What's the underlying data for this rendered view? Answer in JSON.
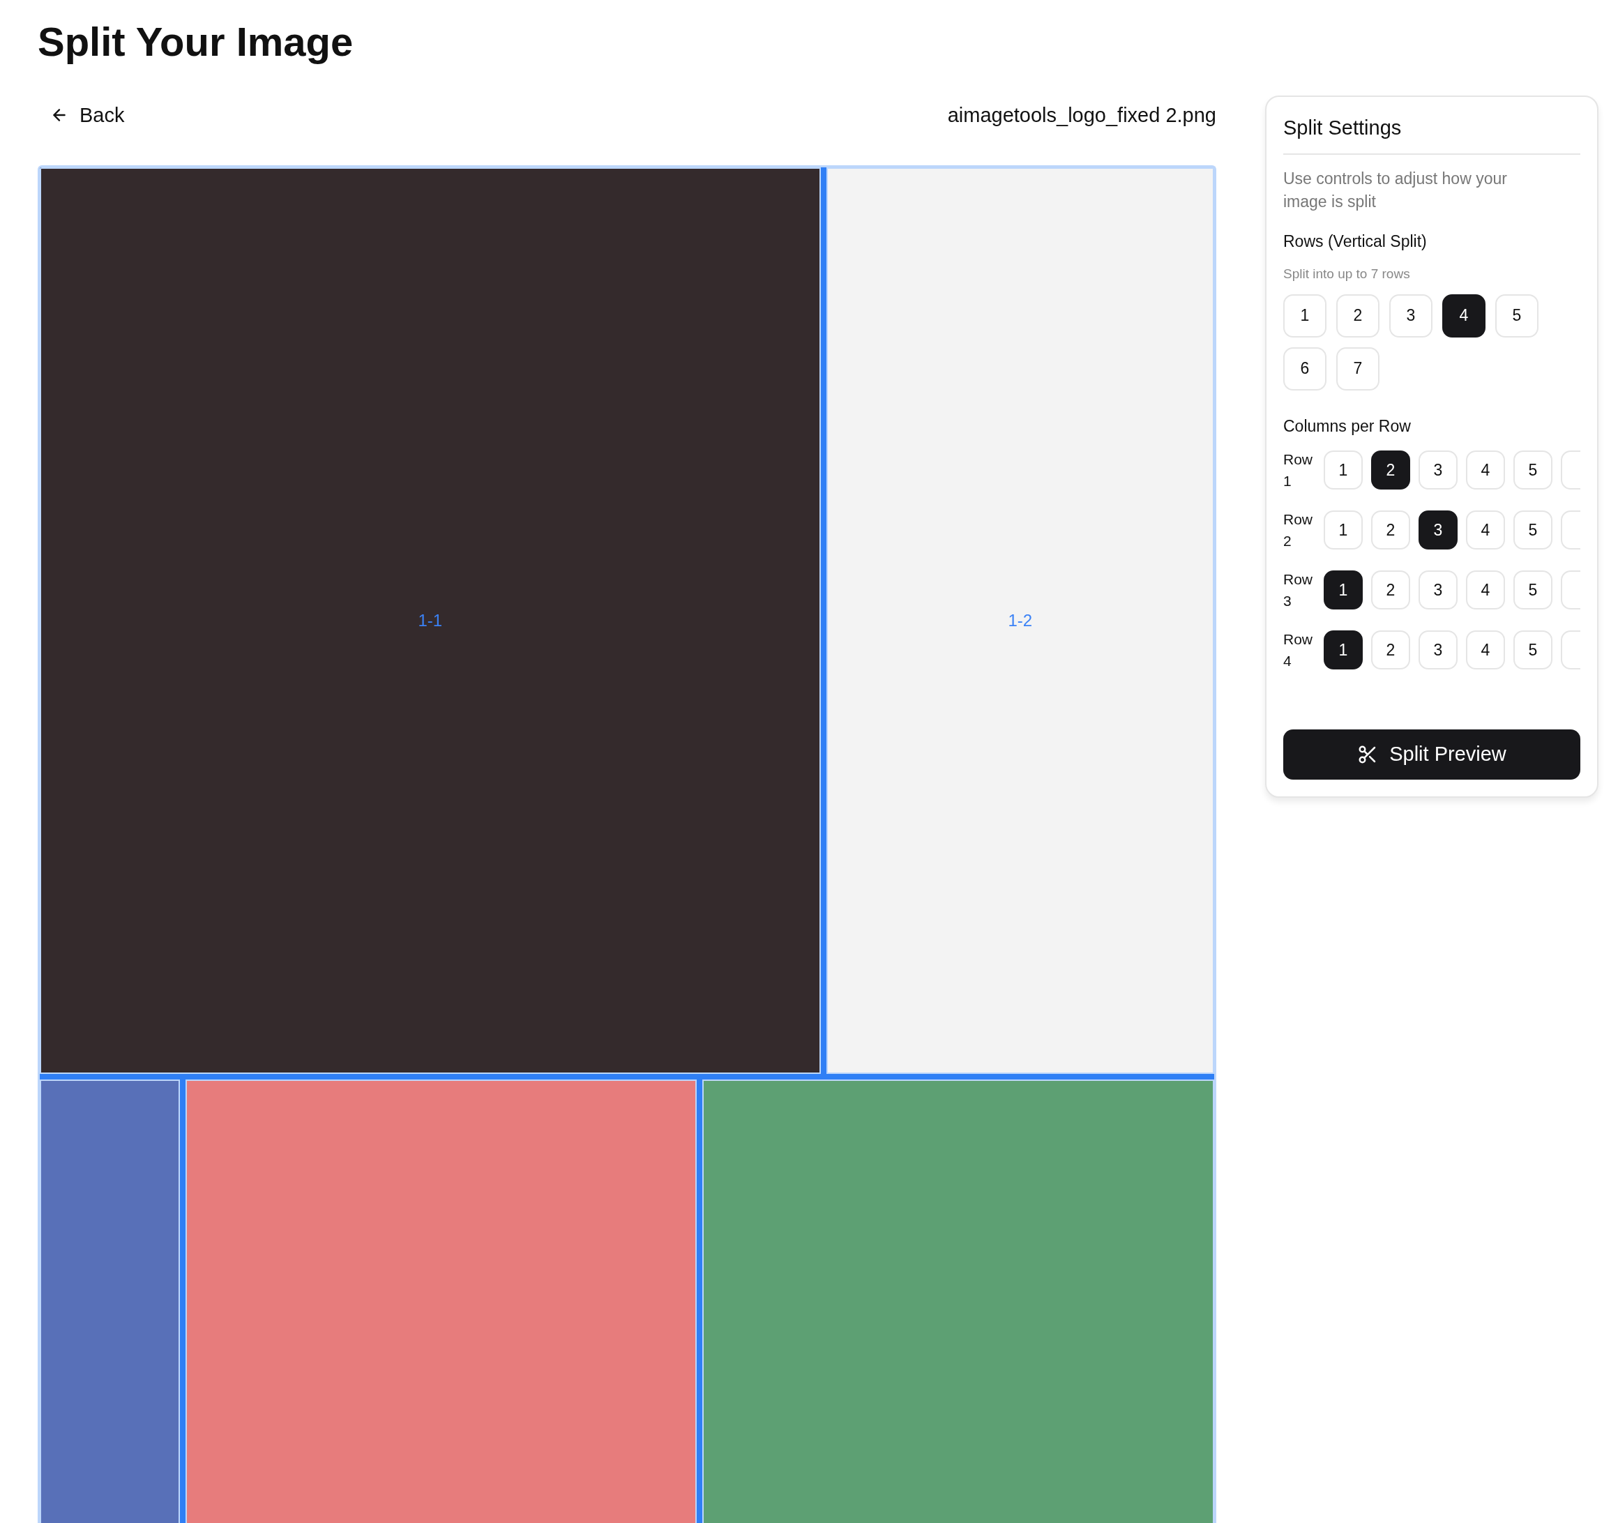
{
  "page_title": "Split Your Image",
  "back_link": "Back",
  "file_name": "aimagetools_logo_fixed 2.png",
  "preview": {
    "rows": [
      {
        "cells": [
          {
            "label": "1-1",
            "color": "#342a2c"
          },
          {
            "label": "1-2",
            "color": "#f3f3f3"
          }
        ]
      },
      {
        "cells": [
          {
            "color": "#5870b8"
          },
          {
            "color": "#e77c7c"
          },
          {
            "color": "#5da073"
          }
        ]
      }
    ]
  },
  "settings": {
    "title": "Split Settings",
    "description": "Use controls to adjust how your image is split",
    "rows_heading": "Rows (Vertical Split)",
    "rows_hint": "Split into up to 7 rows",
    "row_options": [
      {
        "label": "1",
        "selected": false
      },
      {
        "label": "2",
        "selected": false
      },
      {
        "label": "3",
        "selected": false
      },
      {
        "label": "4",
        "selected": true
      },
      {
        "label": "5",
        "selected": false
      },
      {
        "label": "6",
        "selected": false
      },
      {
        "label": "7",
        "selected": false
      }
    ],
    "columns_heading": "Columns per Row",
    "column_rows": [
      {
        "label": "Row 1",
        "options": [
          {
            "label": "1",
            "selected": false
          },
          {
            "label": "2",
            "selected": true
          },
          {
            "label": "3",
            "selected": false
          },
          {
            "label": "4",
            "selected": false
          },
          {
            "label": "5",
            "selected": false
          },
          {
            "selected": false
          }
        ]
      },
      {
        "label": "Row 2",
        "options": [
          {
            "label": "1",
            "selected": false
          },
          {
            "label": "2",
            "selected": false
          },
          {
            "label": "3",
            "selected": true
          },
          {
            "label": "4",
            "selected": false
          },
          {
            "label": "5",
            "selected": false
          },
          {
            "selected": false
          }
        ]
      },
      {
        "label": "Row 3",
        "options": [
          {
            "label": "1",
            "selected": true
          },
          {
            "label": "2",
            "selected": false
          },
          {
            "label": "3",
            "selected": false
          },
          {
            "label": "4",
            "selected": false
          },
          {
            "label": "5",
            "selected": false
          },
          {
            "selected": false
          }
        ]
      },
      {
        "label": "Row 4",
        "options": [
          {
            "label": "1",
            "selected": true
          },
          {
            "label": "2",
            "selected": false
          },
          {
            "label": "3",
            "selected": false
          },
          {
            "label": "4",
            "selected": false
          },
          {
            "label": "5",
            "selected": false
          },
          {
            "selected": false
          }
        ]
      }
    ],
    "action_button": "Split Preview"
  }
}
